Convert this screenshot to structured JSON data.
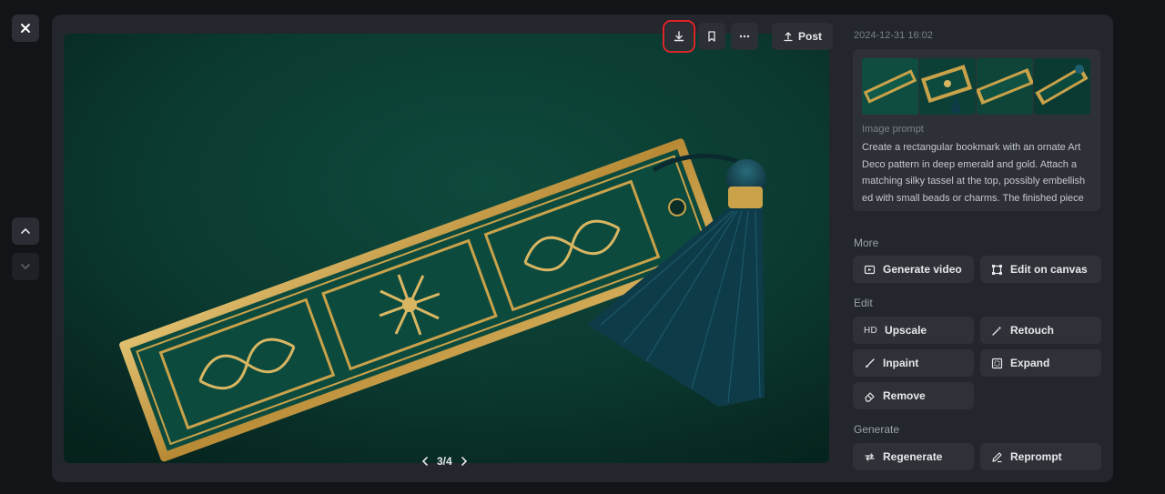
{
  "nav": {
    "close_icon": "close-icon",
    "up_icon": "chevron-up-icon",
    "down_icon": "chevron-down-icon"
  },
  "toolbar": {
    "download_icon": "download-icon",
    "bookmark_icon": "bookmark-icon",
    "more_icon": "more-icon",
    "post_label": "Post",
    "highlight_color": "#e0242b"
  },
  "pager": {
    "text": "3/4"
  },
  "sidebar": {
    "timestamp": "2024-12-31 16:02",
    "prompt_label": "Image prompt",
    "prompt_text": "Create a rectangular bookmark with an ornate Art Deco pattern in deep emerald and gold. Attach a matching silky tassel at the top, possibly embellish ed with small beads or charms. The finished piece",
    "sections": {
      "more": "More",
      "edit": "Edit",
      "generate": "Generate"
    },
    "more_actions": {
      "generate_video": "Generate video",
      "edit_canvas": "Edit on canvas"
    },
    "edit_actions": {
      "upscale": "Upscale",
      "upscale_badge": "HD",
      "retouch": "Retouch",
      "inpaint": "Inpaint",
      "expand": "Expand",
      "remove": "Remove"
    },
    "generate_actions": {
      "regenerate": "Regenerate",
      "reprompt": "Reprompt"
    }
  },
  "colors": {
    "background": "#131417",
    "panel": "#23262c",
    "emerald": "#0f4a3e",
    "gold": "#c9a24a"
  }
}
